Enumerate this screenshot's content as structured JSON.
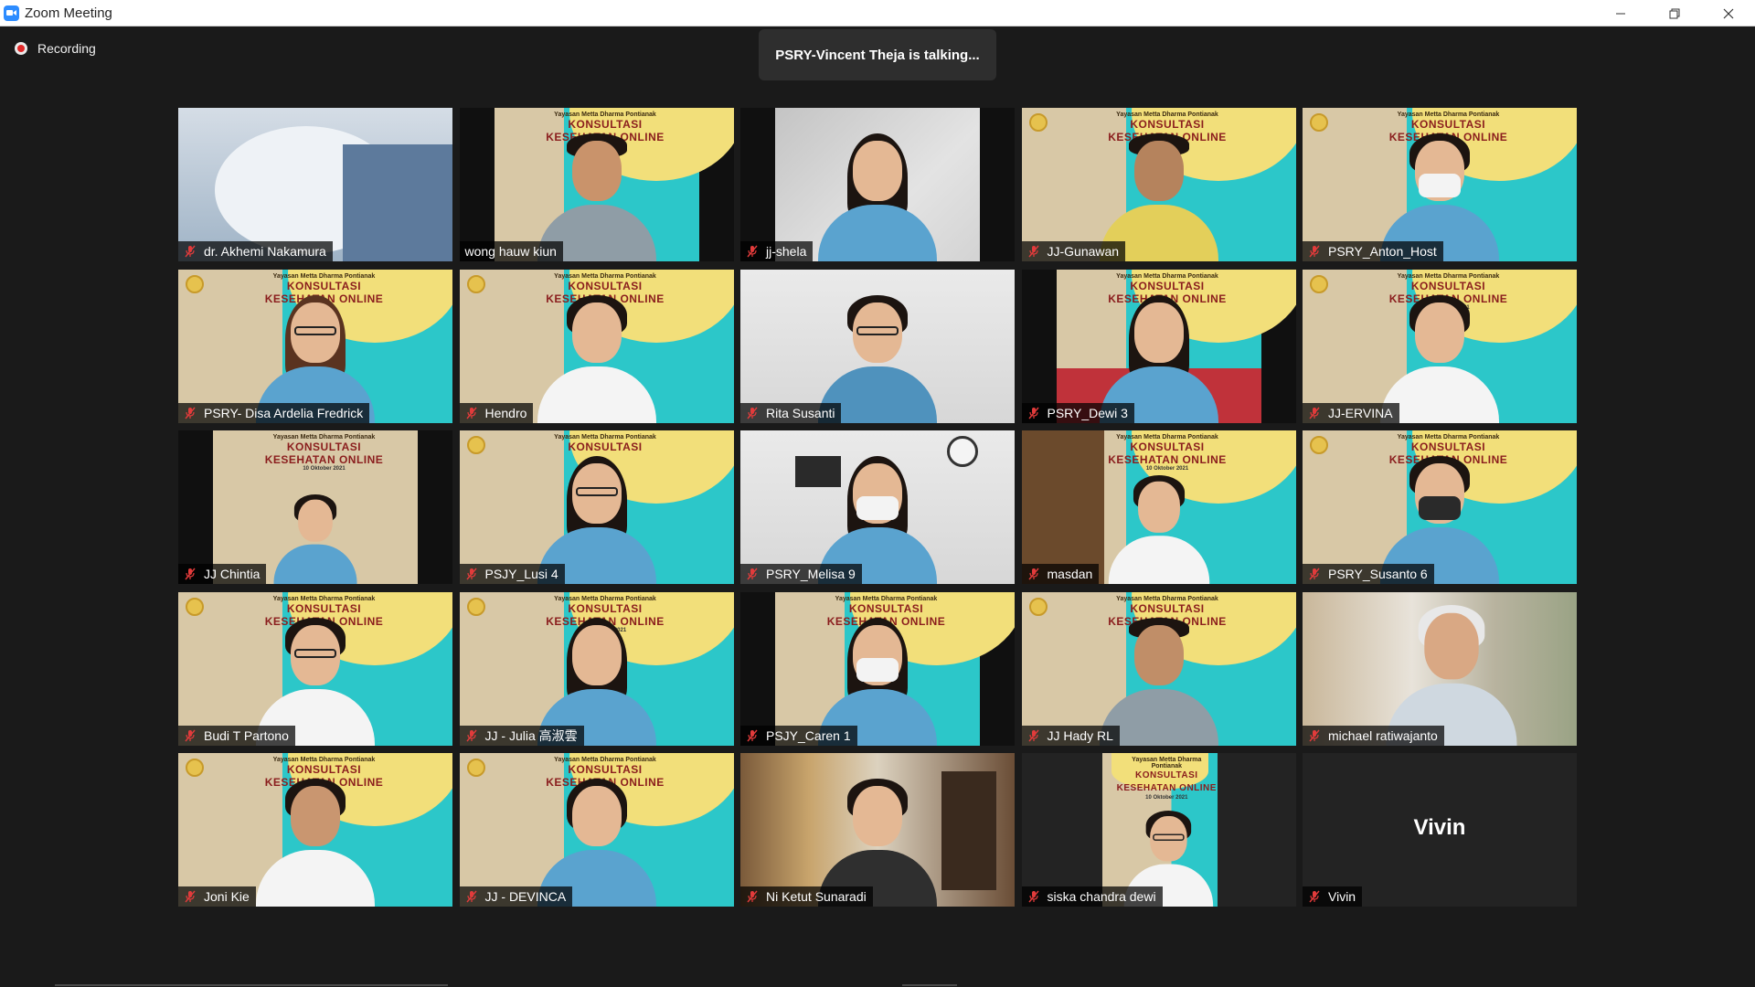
{
  "window": {
    "title": "Zoom Meeting",
    "icon": "zoom-camera-icon",
    "controls": [
      "minimize-icon",
      "restore-icon",
      "close-icon"
    ]
  },
  "recording": {
    "label": "Recording",
    "icon": "recording-dot-icon"
  },
  "active_speaker": {
    "text": "PSRY-Vincent Theja is talking..."
  },
  "banner": {
    "org": "Yayasan Metta Dharma Pontianak",
    "line1": "KONSULTASI",
    "line2": "KESEHATAN ONLINE",
    "date": "10 Oktober 2021"
  },
  "participants": [
    {
      "name": "dr. Akhemi Nakamura",
      "muted": true
    },
    {
      "name": "wong hauw kiun",
      "muted": false
    },
    {
      "name": "jj-shela",
      "muted": true
    },
    {
      "name": "JJ-Gunawan",
      "muted": true
    },
    {
      "name": "PSRY_Anton_Host",
      "muted": true
    },
    {
      "name": "PSRY- Disa Ardelia Fredrick",
      "muted": true
    },
    {
      "name": "Hendro",
      "muted": true
    },
    {
      "name": "Rita Susanti",
      "muted": true
    },
    {
      "name": "PSRY_Dewi 3",
      "muted": true
    },
    {
      "name": "JJ-ERVINA",
      "muted": true
    },
    {
      "name": "JJ Chintia",
      "muted": true
    },
    {
      "name": "PSJY_Lusi 4",
      "muted": true
    },
    {
      "name": "PSRY_Melisa 9",
      "muted": true
    },
    {
      "name": "masdan",
      "muted": true
    },
    {
      "name": "PSRY_Susanto 6",
      "muted": true
    },
    {
      "name": "Budi T Partono",
      "muted": true
    },
    {
      "name": "JJ - Julia 高淑雲",
      "muted": true
    },
    {
      "name": "PSJY_Caren 1",
      "muted": true
    },
    {
      "name": "JJ Hady RL",
      "muted": true
    },
    {
      "name": "michael ratiwajanto",
      "muted": true
    },
    {
      "name": "Joni Kie",
      "muted": true
    },
    {
      "name": "JJ - DEVINCA",
      "muted": true
    },
    {
      "name": "Ni Ketut Sunaradi",
      "muted": true
    },
    {
      "name": "siska chandra dewi",
      "muted": true
    },
    {
      "name": "Vivin",
      "muted": true,
      "video_off": true,
      "display_name": "Vivin"
    }
  ],
  "colors": {
    "muted_mic": "#e23b3b",
    "recording": "#e02828",
    "background": "#1a1a1a"
  }
}
